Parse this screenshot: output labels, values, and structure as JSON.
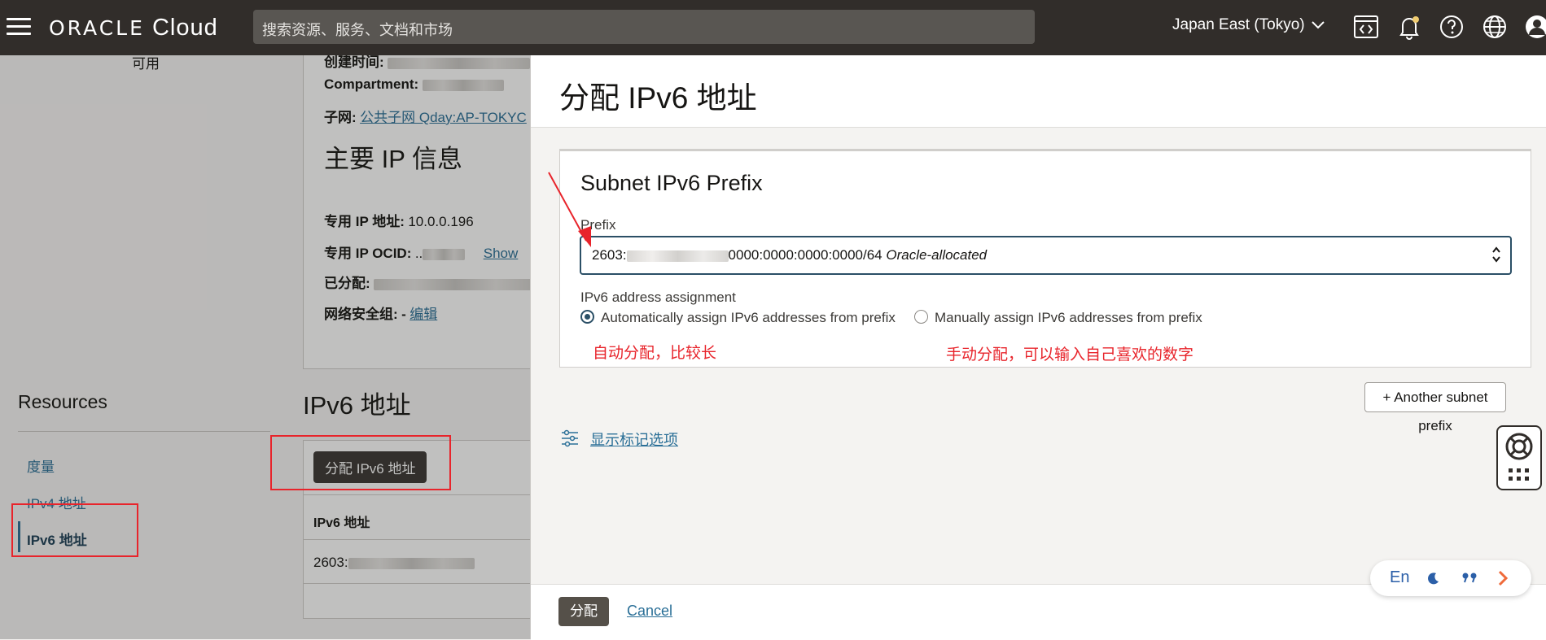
{
  "header": {
    "logo_main": "ORACLE",
    "logo_sub": " Cloud",
    "search_placeholder": "搜索资源、服务、文档和市场",
    "region": "Japan East (Tokyo)",
    "icons": [
      "code-editor-icon",
      "bell-icon",
      "help-icon",
      "globe-icon",
      "profile-icon"
    ]
  },
  "background_page": {
    "status_text": "可用",
    "details": {
      "created_label": "创建时间:",
      "compartment_label": "Compartment:",
      "subnet_label": "子网:",
      "subnet_value": "公共子网 Qday:AP-TOKYC"
    },
    "primary_ip": {
      "title": "主要 IP 信息",
      "private_ip_label": "专用 IP 地址:",
      "private_ip_value": "10.0.0.196",
      "ocid_label": "专用 IP OCID:",
      "ocid_value": "..",
      "show_link": "Show",
      "assigned_label": "已分配:",
      "nsg_label": "网络安全组:",
      "nsg_value": "-",
      "edit_link": "编辑"
    },
    "resources": {
      "title": "Resources",
      "items": [
        {
          "label": "度量"
        },
        {
          "label": "IPv4 地址"
        },
        {
          "label": "IPv6 地址"
        }
      ]
    },
    "ipv6_section": {
      "title": "IPv6 地址",
      "assign_button": "分配 IPv6 地址",
      "column_header": "IPv6 地址",
      "row_value": "2603:"
    }
  },
  "drawer": {
    "title": "分配 IPv6 地址",
    "card_title": "Subnet IPv6 Prefix",
    "prefix_label": "Prefix",
    "prefix_value_start": "2603:",
    "prefix_value_end": "0000:0000:0000:0000/64",
    "prefix_value_note": "Oracle-allocated",
    "assignment_label": "IPv6 address assignment",
    "radio_auto": "Automatically assign IPv6 addresses from prefix",
    "radio_manual": "Manually assign IPv6 addresses from prefix",
    "annotation_auto": "自动分配，比较长",
    "annotation_manual": "手动分配，可以输入自己喜欢的数字",
    "another_prefix_button": "+ Another subnet prefix",
    "tags_link": "显示标记选项",
    "submit_button": "分配",
    "cancel_link": "Cancel"
  },
  "language_widget": {
    "label": "En"
  },
  "colors": {
    "header_bg": "#312d2a",
    "accent": "#2b4f66",
    "link": "#2a6f97",
    "annotation_red": "#e8242b"
  }
}
